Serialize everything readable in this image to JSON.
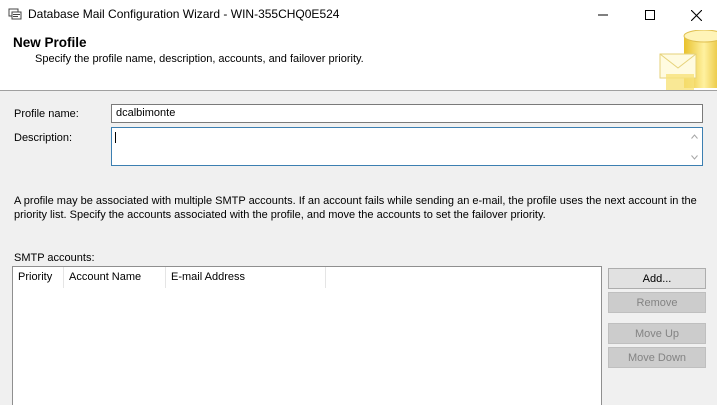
{
  "window": {
    "title": "Database Mail Configuration Wizard - WIN-355CHQ0E524"
  },
  "header": {
    "title": "New Profile",
    "subtitle": "Specify the profile name, description, accounts, and failover priority."
  },
  "form": {
    "profile_name_label": "Profile name:",
    "profile_name_value": "dcalbimonte",
    "description_label": "Description:",
    "description_value": ""
  },
  "info_text": "A profile may be associated with multiple SMTP accounts. If an account fails while sending an e-mail, the profile uses the next account in the priority list. Specify the accounts associated with the profile, and move the accounts to set the failover priority.",
  "smtp": {
    "label": "SMTP accounts:",
    "columns": [
      "Priority",
      "Account Name",
      "E-mail Address"
    ],
    "rows": []
  },
  "buttons": {
    "add": "Add...",
    "remove": "Remove",
    "move_up": "Move Up",
    "move_down": "Move Down"
  },
  "colors": {
    "focus_border": "#3c7fb1",
    "disabled_button": "#cccccc",
    "header_art_yellow": "#f2d23c"
  }
}
